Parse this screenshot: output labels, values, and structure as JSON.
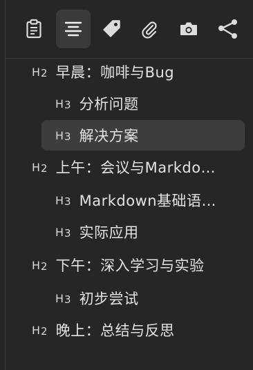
{
  "toolbar": {
    "buttons": [
      {
        "icon": "clipboard-icon",
        "active": false
      },
      {
        "icon": "outline-list-icon",
        "active": true
      },
      {
        "icon": "tag-icon",
        "active": false
      },
      {
        "icon": "paperclip-icon",
        "active": false
      },
      {
        "icon": "camera-icon",
        "active": false
      },
      {
        "icon": "share-graph-icon",
        "active": false
      }
    ]
  },
  "outline": {
    "items": [
      {
        "level_letter": "H",
        "level_num": "2",
        "label": "早晨：咖啡与Bug"
      },
      {
        "level_letter": "H",
        "level_num": "3",
        "label": "分析问题"
      },
      {
        "level_letter": "H",
        "level_num": "3",
        "label": "解决方案"
      },
      {
        "level_letter": "H",
        "level_num": "2",
        "label": "上午：会议与Markdo…"
      },
      {
        "level_letter": "H",
        "level_num": "3",
        "label": "Markdown基础语…"
      },
      {
        "level_letter": "H",
        "level_num": "3",
        "label": "实际应用"
      },
      {
        "level_letter": "H",
        "level_num": "2",
        "label": "下午：深入学习与实验"
      },
      {
        "level_letter": "H",
        "level_num": "3",
        "label": "初步尝试"
      },
      {
        "level_letter": "H",
        "level_num": "2",
        "label": "晚上：总结与反思"
      }
    ]
  }
}
